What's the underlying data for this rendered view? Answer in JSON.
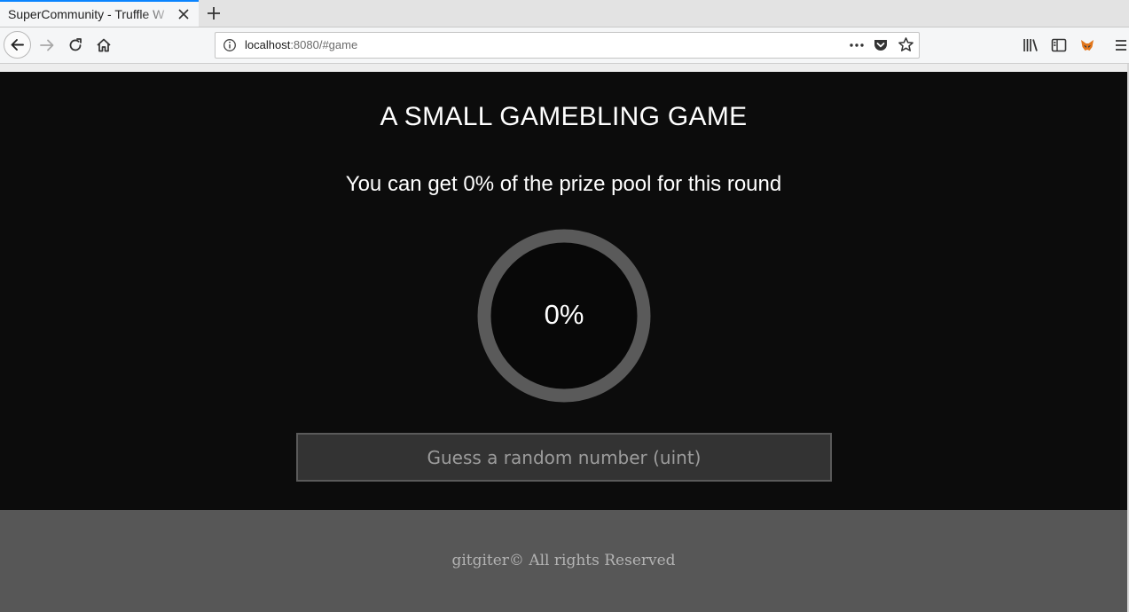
{
  "browser": {
    "tab_title": "SuperCommunity - Truffle W",
    "url_host": "localhost",
    "url_rest": ":8080/#game",
    "accent": "#0a84ff"
  },
  "game": {
    "title": "A SMALL GAMEBLING GAME",
    "prize_text": "You can get 0% of the prize pool for this round",
    "progress_label": "0%",
    "progress_percent": 0,
    "guess_placeholder": "Guess a random number (uint)"
  },
  "footer": {
    "text": "gitgiter© All rights Reserved"
  },
  "colors": {
    "page_bg": "#0c0c0c",
    "ring": "#5a5a5a",
    "footer_bg": "#575757"
  }
}
